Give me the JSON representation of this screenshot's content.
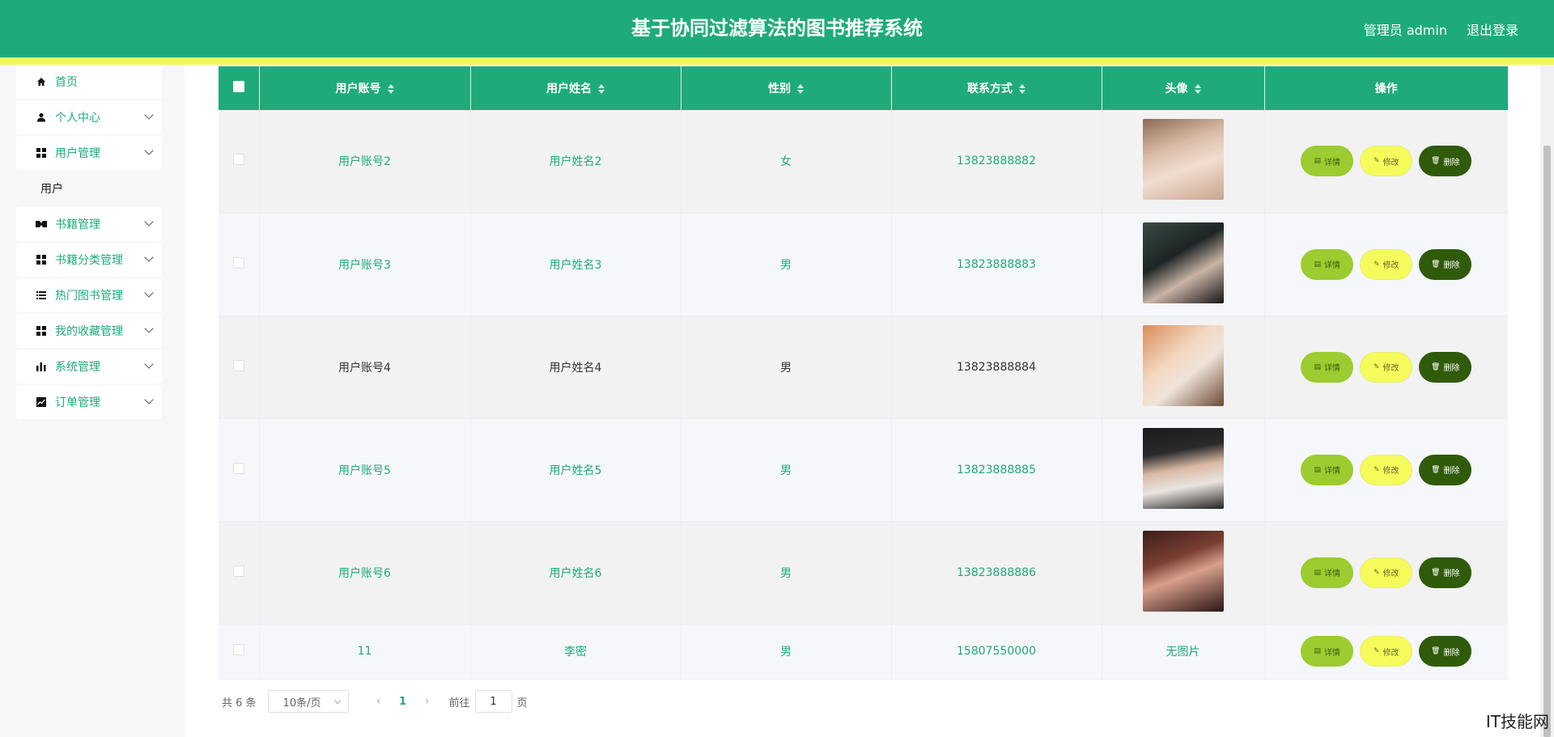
{
  "header": {
    "title": "基于协同过滤算法的图书推荐系统",
    "user_label": "管理员 admin",
    "logout_label": "退出登录",
    "bg_color": "#1fab79"
  },
  "sidebar": {
    "items": [
      {
        "label": "首页",
        "icon": "home-icon"
      },
      {
        "label": "个人中心",
        "icon": "user-icon"
      },
      {
        "label": "用户管理",
        "icon": "grid-icon"
      },
      {
        "label": "书籍管理",
        "icon": "book-icon"
      },
      {
        "label": "书籍分类管理",
        "icon": "grid-icon"
      },
      {
        "label": "热门图书管理",
        "icon": "list-icon"
      },
      {
        "label": "我的收藏管理",
        "icon": "grid-icon"
      },
      {
        "label": "系统管理",
        "icon": "bar-chart-icon"
      },
      {
        "label": "订单管理",
        "icon": "line-chart-icon"
      }
    ],
    "sub_item": "用户"
  },
  "table": {
    "headers": [
      "用户账号",
      "用户姓名",
      "性别",
      "联系方式",
      "头像",
      "操作"
    ],
    "rows": [
      {
        "account": "用户账号2",
        "name": "用户姓名2",
        "gender": "女",
        "phone": "13823888882",
        "avatar": "photo"
      },
      {
        "account": "用户账号3",
        "name": "用户姓名3",
        "gender": "男",
        "phone": "13823888883",
        "avatar": "photo"
      },
      {
        "account": "用户账号4",
        "name": "用户姓名4",
        "gender": "男",
        "phone": "13823888884",
        "avatar": "photo"
      },
      {
        "account": "用户账号5",
        "name": "用户姓名5",
        "gender": "男",
        "phone": "13823888885",
        "avatar": "photo"
      },
      {
        "account": "用户账号6",
        "name": "用户姓名6",
        "gender": "男",
        "phone": "13823888886",
        "avatar": "photo"
      },
      {
        "account": "11",
        "name": "李密",
        "gender": "男",
        "phone": "15807550000",
        "avatar_text": "无图片"
      }
    ],
    "actions": {
      "detail": "详情",
      "edit": "修改",
      "delete": "删除"
    }
  },
  "pagination": {
    "total": "共 6 条",
    "page_size": "10条/页",
    "current_page": "1",
    "goto_prefix": "前往",
    "goto_value": "1",
    "goto_suffix": "页"
  },
  "watermark": "IT技能网"
}
